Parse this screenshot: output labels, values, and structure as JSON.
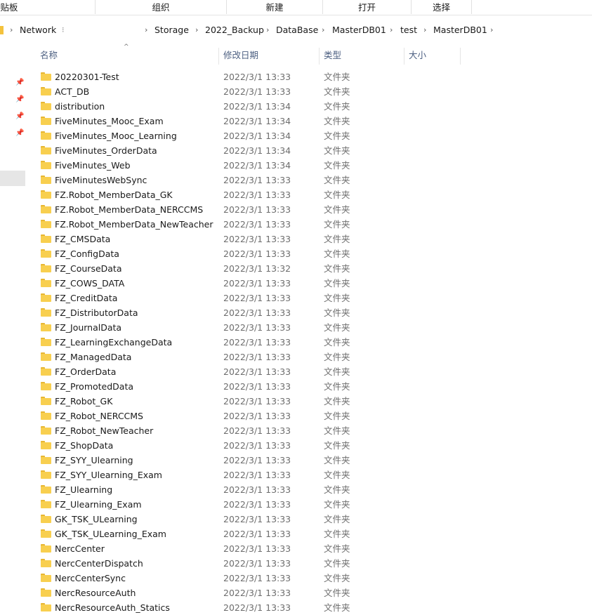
{
  "ribbon": {
    "groups": [
      "贴板",
      "组织",
      "新建",
      "打开",
      "选择"
    ]
  },
  "address": {
    "crumbs": [
      "Network",
      "Storage",
      "2022_Backup",
      "DataBase",
      "MasterDB01",
      "test",
      "MasterDB01"
    ]
  },
  "columns": {
    "name": "名称",
    "modified": "修改日期",
    "type": "类型",
    "size": "大小"
  },
  "rows": [
    {
      "name": "20220301-Test",
      "date": "2022/3/1 13:33",
      "type": "文件夹"
    },
    {
      "name": "ACT_DB",
      "date": "2022/3/1 13:33",
      "type": "文件夹"
    },
    {
      "name": "distribution",
      "date": "2022/3/1 13:34",
      "type": "文件夹"
    },
    {
      "name": "FiveMinutes_Mooc_Exam",
      "date": "2022/3/1 13:34",
      "type": "文件夹"
    },
    {
      "name": "FiveMinutes_Mooc_Learning",
      "date": "2022/3/1 13:34",
      "type": "文件夹"
    },
    {
      "name": "FiveMinutes_OrderData",
      "date": "2022/3/1 13:34",
      "type": "文件夹"
    },
    {
      "name": "FiveMinutes_Web",
      "date": "2022/3/1 13:34",
      "type": "文件夹"
    },
    {
      "name": "FiveMinutesWebSync",
      "date": "2022/3/1 13:33",
      "type": "文件夹"
    },
    {
      "name": "FZ.Robot_MemberData_GK",
      "date": "2022/3/1 13:33",
      "type": "文件夹"
    },
    {
      "name": "FZ.Robot_MemberData_NERCCMS",
      "date": "2022/3/1 13:33",
      "type": "文件夹"
    },
    {
      "name": "FZ.Robot_MemberData_NewTeacher",
      "date": "2022/3/1 13:33",
      "type": "文件夹"
    },
    {
      "name": "FZ_CMSData",
      "date": "2022/3/1 13:33",
      "type": "文件夹"
    },
    {
      "name": "FZ_ConfigData",
      "date": "2022/3/1 13:33",
      "type": "文件夹"
    },
    {
      "name": "FZ_CourseData",
      "date": "2022/3/1 13:32",
      "type": "文件夹"
    },
    {
      "name": "FZ_COWS_DATA",
      "date": "2022/3/1 13:33",
      "type": "文件夹"
    },
    {
      "name": "FZ_CreditData",
      "date": "2022/3/1 13:33",
      "type": "文件夹"
    },
    {
      "name": "FZ_DistributorData",
      "date": "2022/3/1 13:33",
      "type": "文件夹"
    },
    {
      "name": "FZ_JournalData",
      "date": "2022/3/1 13:33",
      "type": "文件夹"
    },
    {
      "name": "FZ_LearningExchangeData",
      "date": "2022/3/1 13:33",
      "type": "文件夹"
    },
    {
      "name": "FZ_ManagedData",
      "date": "2022/3/1 13:33",
      "type": "文件夹"
    },
    {
      "name": "FZ_OrderData",
      "date": "2022/3/1 13:33",
      "type": "文件夹"
    },
    {
      "name": "FZ_PromotedData",
      "date": "2022/3/1 13:33",
      "type": "文件夹"
    },
    {
      "name": "FZ_Robot_GK",
      "date": "2022/3/1 13:33",
      "type": "文件夹"
    },
    {
      "name": "FZ_Robot_NERCCMS",
      "date": "2022/3/1 13:33",
      "type": "文件夹"
    },
    {
      "name": "FZ_Robot_NewTeacher",
      "date": "2022/3/1 13:33",
      "type": "文件夹"
    },
    {
      "name": "FZ_ShopData",
      "date": "2022/3/1 13:33",
      "type": "文件夹"
    },
    {
      "name": "FZ_SYY_Ulearning",
      "date": "2022/3/1 13:33",
      "type": "文件夹"
    },
    {
      "name": "FZ_SYY_Ulearning_Exam",
      "date": "2022/3/1 13:33",
      "type": "文件夹"
    },
    {
      "name": "FZ_Ulearning",
      "date": "2022/3/1 13:33",
      "type": "文件夹"
    },
    {
      "name": "FZ_Ulearning_Exam",
      "date": "2022/3/1 13:33",
      "type": "文件夹"
    },
    {
      "name": "GK_TSK_ULearning",
      "date": "2022/3/1 13:33",
      "type": "文件夹"
    },
    {
      "name": "GK_TSK_ULearning_Exam",
      "date": "2022/3/1 13:33",
      "type": "文件夹"
    },
    {
      "name": "NercCenter",
      "date": "2022/3/1 13:33",
      "type": "文件夹"
    },
    {
      "name": "NercCenterDispatch",
      "date": "2022/3/1 13:33",
      "type": "文件夹"
    },
    {
      "name": "NercCenterSync",
      "date": "2022/3/1 13:33",
      "type": "文件夹"
    },
    {
      "name": "NercResourceAuth",
      "date": "2022/3/1 13:33",
      "type": "文件夹"
    },
    {
      "name": "NercResourceAuth_Statics",
      "date": "2022/3/1 13:33",
      "type": "文件夹"
    }
  ]
}
